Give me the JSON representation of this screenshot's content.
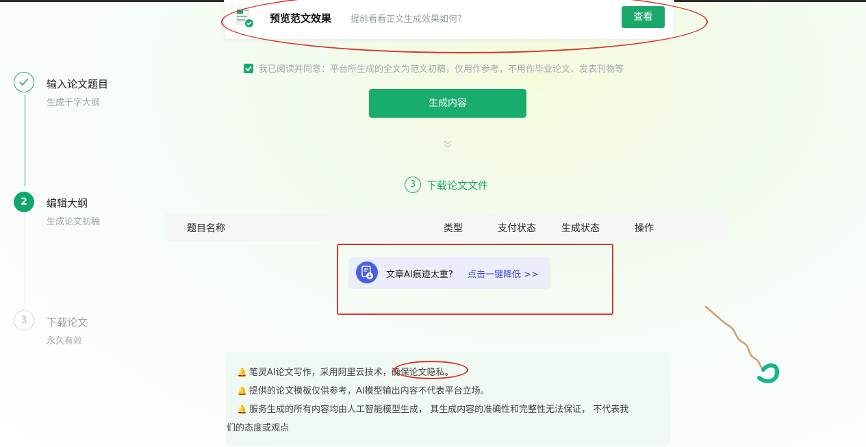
{
  "preview": {
    "title": "预览范文效果",
    "description": "提前看看正文生成效果如何?",
    "button": "查看"
  },
  "agreement": {
    "checked": true,
    "text": "我已阅读并同意：平台所生成的全文为范文初稿，仅用作参考，不用作毕业论文、发表刊物等"
  },
  "generate_button": "生成内容",
  "download_section": {
    "step_number": "3",
    "heading": "下载论文文件"
  },
  "table": {
    "columns": [
      "题目名称",
      "类型",
      "支付状态",
      "生成状态",
      "操作"
    ]
  },
  "ai_promo": {
    "text": "文章AI痕迹太重?",
    "link": "点击一键降低 >>"
  },
  "stepper": [
    {
      "number": "",
      "title": "输入论文题目",
      "subtitle": "生成千字大纲",
      "state": "done"
    },
    {
      "number": "2",
      "title": "编辑大纲",
      "subtitle": "生成论文初稿",
      "state": "active"
    },
    {
      "number": "3",
      "title": "下载论文",
      "subtitle": "永久有效",
      "state": "pending"
    }
  ],
  "notices": [
    "笔灵AI论文写作，采用阿里云技术，确保论文隐私。",
    "提供的论文模板仅供参考，AI模型输出内容不代表平台立场。",
    "服务生成的所有内容均由人工智能模型生成， 其生成内容的准确性和完整性无法保证， 不代表我",
    "们的态度或观点"
  ],
  "colors": {
    "accent": "#1aa96a",
    "annotation_red": "#d9362a",
    "link_blue": "#3b4de3"
  }
}
